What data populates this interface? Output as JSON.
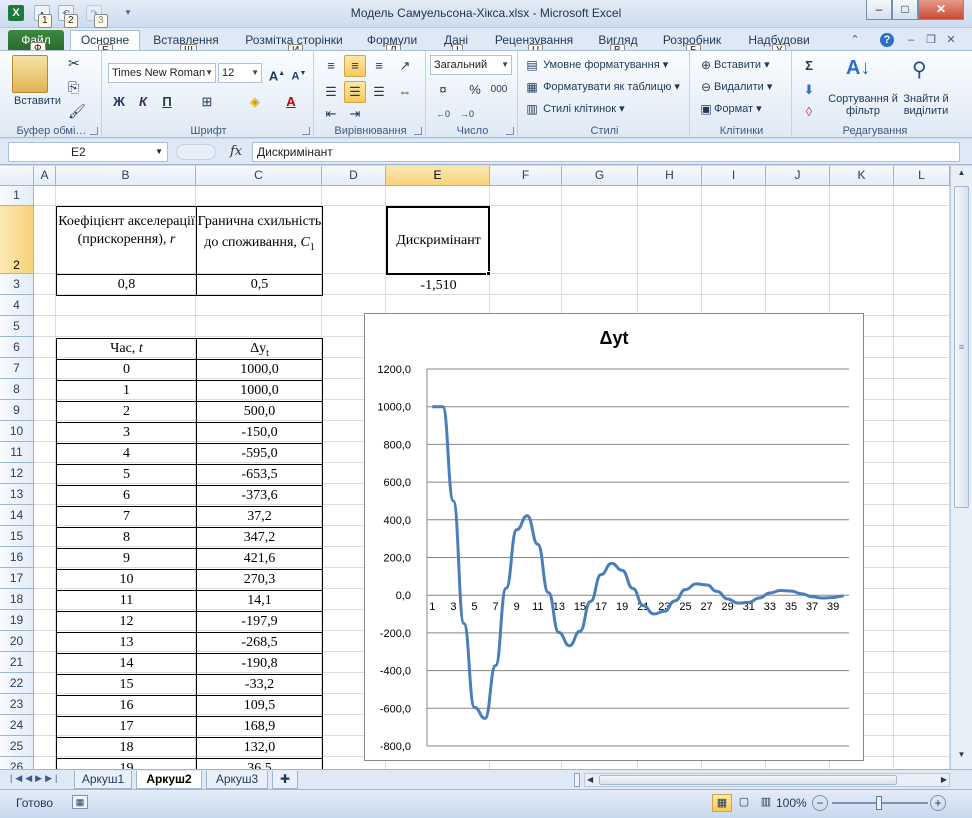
{
  "window": {
    "title": "Модель Самуельсона-Хікса.xlsx  -  Microsoft Excel",
    "qat_keytips": [
      "1",
      "2",
      "3"
    ],
    "minimize": "–",
    "maximize": "□",
    "close": "✕"
  },
  "tabs": [
    {
      "label": "Файл",
      "key": "Ф"
    },
    {
      "label": "Основне",
      "key": "Е"
    },
    {
      "label": "Вставлення",
      "key": "Щ"
    },
    {
      "label": "Розмітка сторінки",
      "key": "И"
    },
    {
      "label": "Формули",
      "key": "Л"
    },
    {
      "label": "Дані",
      "key": "І"
    },
    {
      "label": "Рецензування",
      "key": "Ц"
    },
    {
      "label": "Вигляд",
      "key": "В"
    },
    {
      "label": "Розробник",
      "key": "Б"
    },
    {
      "label": "Надбудови",
      "key": "У"
    }
  ],
  "ribbon": {
    "clipboard": {
      "label": "Буфер обмі…",
      "paste": "Вставити"
    },
    "font": {
      "label": "Шрифт",
      "font_name": "Times New Roman",
      "font_size": "12",
      "bold": "Ж",
      "italic": "К",
      "underline": "П"
    },
    "alignment": {
      "label": "Вирівнювання"
    },
    "number": {
      "label": "Число",
      "format": "Загальний",
      "percent": "%",
      "thousands": "000"
    },
    "styles": {
      "label": "Стилі",
      "conditional": "Умовне форматування",
      "as_table": "Форматувати як таблицю",
      "cell_styles": "Стилі клітинок"
    },
    "cells": {
      "label": "Клітинки",
      "insert": "Вставити",
      "delete": "Видалити",
      "format": "Формат"
    },
    "editing": {
      "label": "Редагування",
      "sum": "Σ",
      "sort": "Сортування й фільтр",
      "find": "Знайти й виділити"
    }
  },
  "formula_bar": {
    "name_box": "E2",
    "fx": "fx",
    "content": "Дискримінант"
  },
  "columns": [
    "A",
    "B",
    "C",
    "D",
    "E",
    "F",
    "G",
    "H",
    "I",
    "J",
    "K",
    "L"
  ],
  "rows": [
    "1",
    "2",
    "3",
    "4",
    "5",
    "6",
    "7",
    "8",
    "9",
    "10",
    "11",
    "12",
    "13",
    "14",
    "15",
    "16",
    "17",
    "18",
    "19",
    "20",
    "21",
    "22",
    "23",
    "24",
    "25",
    "26"
  ],
  "params": {
    "b2": "Коефіцієнт акселерації (прискорення),",
    "b2_var": "r",
    "c2": "Гранична схильність до споживання,",
    "c2_var": "C",
    "c2_sub": "1",
    "b3": "0,8",
    "c3": "0,5",
    "e2": "Дискримінант",
    "e3": "-1,510"
  },
  "table": {
    "header_t": "Час,",
    "header_t_var": "t",
    "header_y": "Δy",
    "header_y_sub": "t",
    "rows": [
      {
        "t": "0",
        "y": "1000,0"
      },
      {
        "t": "1",
        "y": "1000,0"
      },
      {
        "t": "2",
        "y": "500,0"
      },
      {
        "t": "3",
        "y": "-150,0"
      },
      {
        "t": "4",
        "y": "-595,0"
      },
      {
        "t": "5",
        "y": "-653,5"
      },
      {
        "t": "6",
        "y": "-373,6"
      },
      {
        "t": "7",
        "y": "37,2"
      },
      {
        "t": "8",
        "y": "347,2"
      },
      {
        "t": "9",
        "y": "421,6"
      },
      {
        "t": "10",
        "y": "270,3"
      },
      {
        "t": "11",
        "y": "14,1"
      },
      {
        "t": "12",
        "y": "-197,9"
      },
      {
        "t": "13",
        "y": "-268,5"
      },
      {
        "t": "14",
        "y": "-190,8"
      },
      {
        "t": "15",
        "y": "-33,2"
      },
      {
        "t": "16",
        "y": "109,5"
      },
      {
        "t": "17",
        "y": "168,9"
      },
      {
        "t": "18",
        "y": "132,0"
      },
      {
        "t": "19",
        "y": "36,5"
      }
    ]
  },
  "chart_data": {
    "type": "line",
    "title": "Δyt",
    "ylim": [
      -800,
      1200
    ],
    "y_ticks": [
      "1200,0",
      "1000,0",
      "800,0",
      "600,0",
      "400,0",
      "200,0",
      "0,0",
      "-200,0",
      "-400,0",
      "-600,0",
      "-800,0"
    ],
    "x_ticks": [
      "1",
      "3",
      "5",
      "7",
      "9",
      "11",
      "13",
      "15",
      "17",
      "19",
      "21",
      "23",
      "25",
      "27",
      "29",
      "31",
      "33",
      "35",
      "37",
      "39"
    ],
    "grid": true,
    "color": "#4a7ebb",
    "x": [
      1,
      2,
      3,
      4,
      5,
      6,
      7,
      8,
      9,
      10,
      11,
      12,
      13,
      14,
      15,
      16,
      17,
      18,
      19,
      20,
      21,
      22,
      23,
      24,
      25,
      26,
      27,
      28,
      29,
      30,
      31,
      32,
      33,
      34,
      35,
      36,
      37,
      38,
      39,
      40
    ],
    "values": [
      1000,
      1000,
      500,
      -150,
      -595,
      -653.5,
      -373.6,
      37.2,
      347.2,
      421.6,
      270.3,
      14.1,
      -197.9,
      -268.5,
      -190.8,
      -33.2,
      109.5,
      168.9,
      132.0,
      36.5,
      -55,
      -100,
      -85,
      -30,
      30,
      60,
      55,
      20,
      -20,
      -42,
      -38,
      -15,
      12,
      25,
      22,
      8,
      -8,
      -15,
      -12,
      -4
    ]
  },
  "sheets": [
    "Аркуш1",
    "Аркуш2",
    "Аркуш3"
  ],
  "active_sheet": "Аркуш2",
  "status": {
    "ready": "Готово",
    "zoom": "100%"
  }
}
